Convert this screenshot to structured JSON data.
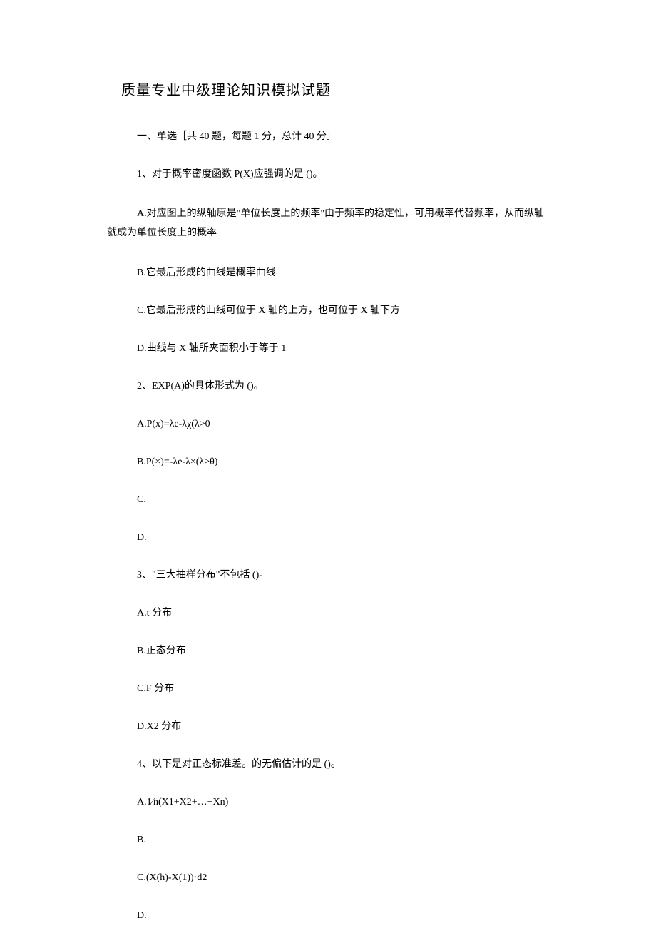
{
  "title": "质量专业中级理论知识模拟试题",
  "section_header": "一、单选［共 40 题，每题 1 分，总计 40 分］",
  "q1": {
    "stem": "1、对于概率密度函数 P(X)应强调的是 ()。",
    "optA_part1": "A.对应图上的纵轴原是\"单位长度上的频率\"由于频率的稳定性，可用概率代替频率，从而纵轴",
    "optA_part2": "就成为单位长度上的概率",
    "optB": "B.它最后形成的曲线是概率曲线",
    "optC": "C.它最后形成的曲线可位于 X 轴的上方，也可位于 X 轴下方",
    "optD": "D.曲线与 X 轴所夹面积小于等于 1"
  },
  "q2": {
    "stem": "2、EXP(A)的具体形式为 ()。",
    "optA": "A.P(x)=λe-λχ(λ>0",
    "optB": "B.P(×)=-λe-λ×(λ>θ)",
    "optC": "C.",
    "optD": "D."
  },
  "q3": {
    "stem": "3、\"三大抽样分布\"不包括 ()。",
    "optA": "A.t 分布",
    "optB": "B.正态分布",
    "optC": "C.F 分布",
    "optD": "D.X2 分布"
  },
  "q4": {
    "stem": "4、以下是对正态标准差。的无偏估计的是 ()。",
    "optA": "A.1⁄n(X1+X2+…+Xn)",
    "optB": "B.",
    "optC": "C.(X(h)-X(1))·d2",
    "optD": "D."
  }
}
